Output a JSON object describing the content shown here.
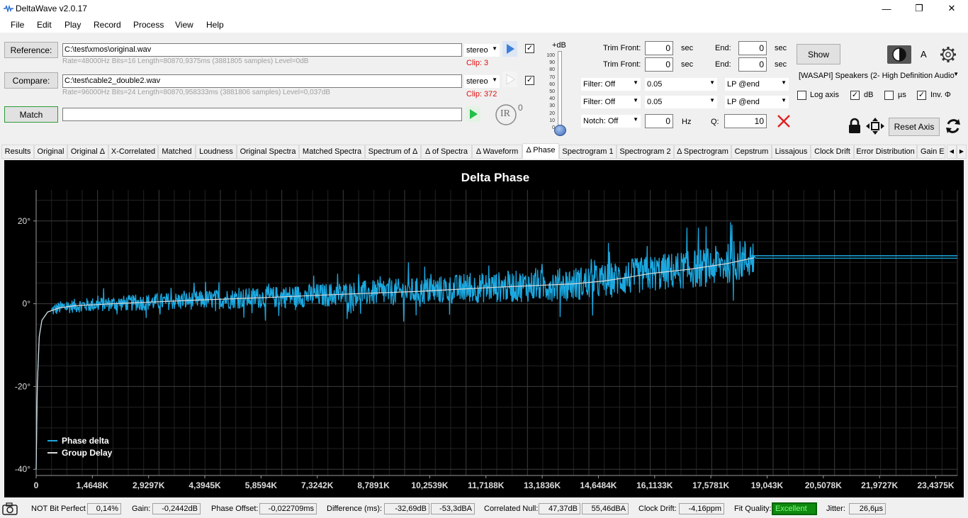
{
  "window": {
    "title": "DeltaWave v2.0.17",
    "minimize": "—",
    "maximize": "❐",
    "close": "✕"
  },
  "menu": [
    "File",
    "Edit",
    "Play",
    "Record",
    "Process",
    "View",
    "Help"
  ],
  "reference": {
    "button": "Reference:",
    "path": "C:\\test\\xmos\\original.wav",
    "channels": "stereo",
    "clip": "Clip: 3",
    "info": "Rate=48000Hz Bits=16 Length=80870,9375ms (3881805 samples) Level=0dB"
  },
  "compare": {
    "button": "Compare:",
    "path": "C:\\test\\cable2_double2.wav",
    "channels": "stereo",
    "clip": "Clip: 372",
    "info": "Rate=96000Hz Bits=24 Length=80870,958333ms (3881806 samples) Level=0,037dB"
  },
  "match": {
    "button": "Match",
    "value": ""
  },
  "ir_logo": "IR",
  "ir_superscript": "0",
  "volume": {
    "title": "+dB",
    "ticks": [
      "100",
      "90",
      "80",
      "70",
      "60",
      "50",
      "40",
      "30",
      "20",
      "10",
      "0"
    ]
  },
  "trim": {
    "front_label": "Trim Front:",
    "front1": "0",
    "front2": "0",
    "end_label": "End:",
    "end1": "0",
    "end2": "0",
    "unit": "sec"
  },
  "filters": [
    {
      "type": "Filter: Off",
      "value": "0.05",
      "lp": "LP @end"
    },
    {
      "type": "Filter: Off",
      "value": "0.05",
      "lp": "LP @end"
    }
  ],
  "notch": {
    "type": "Notch: Off",
    "hz_value": "0",
    "hz_label": "Hz",
    "q_label": "Q:",
    "q_value": "10"
  },
  "show_button": "Show",
  "font_a": "A",
  "device": "[WASAPI] Speakers (2- High Definition Audio",
  "options": [
    {
      "label": "Log axis",
      "checked": false
    },
    {
      "label": "dB",
      "checked": true
    },
    {
      "label": "µs",
      "checked": false
    },
    {
      "label": "Inv. Φ",
      "checked": true
    }
  ],
  "reset_axis": "Reset Axis",
  "tabs": [
    "Results",
    "Original",
    "Original Δ",
    "X-Correlated",
    "Matched",
    "Loudness",
    "Original Spectra",
    "Matched Spectra",
    "Spectrum of Δ",
    "Δ of Spectra",
    "Δ Waveform",
    "Δ Phase",
    "Spectrogram 1",
    "Spectrogram 2",
    "Δ Spectrogram",
    "Cepstrum",
    "Lissajous",
    "Clock Drift",
    "Error Distribution",
    "Gain E"
  ],
  "active_tab": "Δ Phase",
  "chart_data": {
    "type": "line",
    "title": "Delta Phase",
    "xlabel": "",
    "ylabel": "",
    "x_ticks": [
      "0",
      "1,4648K",
      "2,9297K",
      "4,3945K",
      "5,8594K",
      "7,3242K",
      "8,7891K",
      "10,2539K",
      "11,7188K",
      "13,1836K",
      "14,6484K",
      "16,1133K",
      "17,5781K",
      "19,043K",
      "20,5078K",
      "21,9727K",
      "23,4375K"
    ],
    "x_tick_values": [
      0,
      1464.8,
      2929.7,
      4394.5,
      5859.4,
      7324.2,
      8789.1,
      10253.9,
      11718.8,
      13183.6,
      14648.4,
      16113.3,
      17578.1,
      19043,
      20507.8,
      21972.7,
      23437.5
    ],
    "y_ticks": [
      "20°",
      "0°",
      "-20°",
      "-40°"
    ],
    "y_tick_values": [
      20,
      0,
      -20,
      -40
    ],
    "xlim": [
      0,
      24000
    ],
    "ylim": [
      -41.5,
      27.5
    ],
    "grid": true,
    "legend_position": "bottom-left",
    "colors": {
      "phase": "#1ba8e0",
      "group": "#d8d8d8",
      "background": "#000000",
      "grid": "#3a3a3a"
    },
    "series": [
      {
        "name": "Phase delta",
        "x": [
          0,
          30,
          80,
          150,
          300,
          600,
          1000,
          1500,
          2000,
          3000,
          4000,
          5000,
          6000,
          7000,
          8000,
          9000,
          10000,
          11000,
          12000,
          13000,
          14000,
          14800,
          15500,
          16000,
          17000,
          17500,
          18000,
          18500,
          18700,
          18750,
          20000,
          22000,
          24000
        ],
        "y": [
          -40,
          -20,
          -8,
          -4,
          -2,
          -1,
          -0.5,
          -0.2,
          0,
          0.4,
          0.8,
          1.2,
          1.5,
          1.9,
          2.3,
          2.7,
          3.0,
          3.6,
          4.0,
          4.4,
          4.8,
          5.5,
          6.5,
          7.3,
          8.3,
          8.8,
          9.7,
          10.8,
          11.1,
          11.0,
          11.0,
          11.0,
          11.0
        ]
      },
      {
        "name": "Group Delay",
        "x": [
          0,
          30,
          80,
          150,
          300,
          600,
          1000,
          2000,
          4000,
          6000,
          8000,
          10000,
          12000,
          14000,
          14800,
          15500,
          16000,
          17000,
          18000,
          18700
        ],
        "y": [
          -40,
          -20,
          -8,
          -4,
          -2,
          -1,
          -0.5,
          0,
          0.8,
          1.5,
          2.3,
          3.0,
          4.0,
          4.8,
          5.5,
          6.5,
          7.3,
          8.3,
          9.7,
          11.1
        ]
      }
    ]
  },
  "status": {
    "bitperfect_label": "NOT Bit Perfect",
    "bitperfect_value": "0,14%",
    "gain_label": "Gain:",
    "gain_value": "-0,2442dB",
    "phase_label": "Phase Offset:",
    "phase_value": "-0,022709ms",
    "diff_label": "Difference (ms):",
    "diff_value1": "-32,69dB",
    "diff_value2": "-53,3dBA",
    "null_label": "Correlated Null:",
    "null_value1": "47,37dB",
    "null_value2": "55,46dBA",
    "drift_label": "Clock Drift:",
    "drift_value": "-4,16ppm",
    "fit_label": "Fit Quality:",
    "fit_value": "Excellent",
    "jitter_label": "Jitter:",
    "jitter_value": "26,6µs"
  }
}
